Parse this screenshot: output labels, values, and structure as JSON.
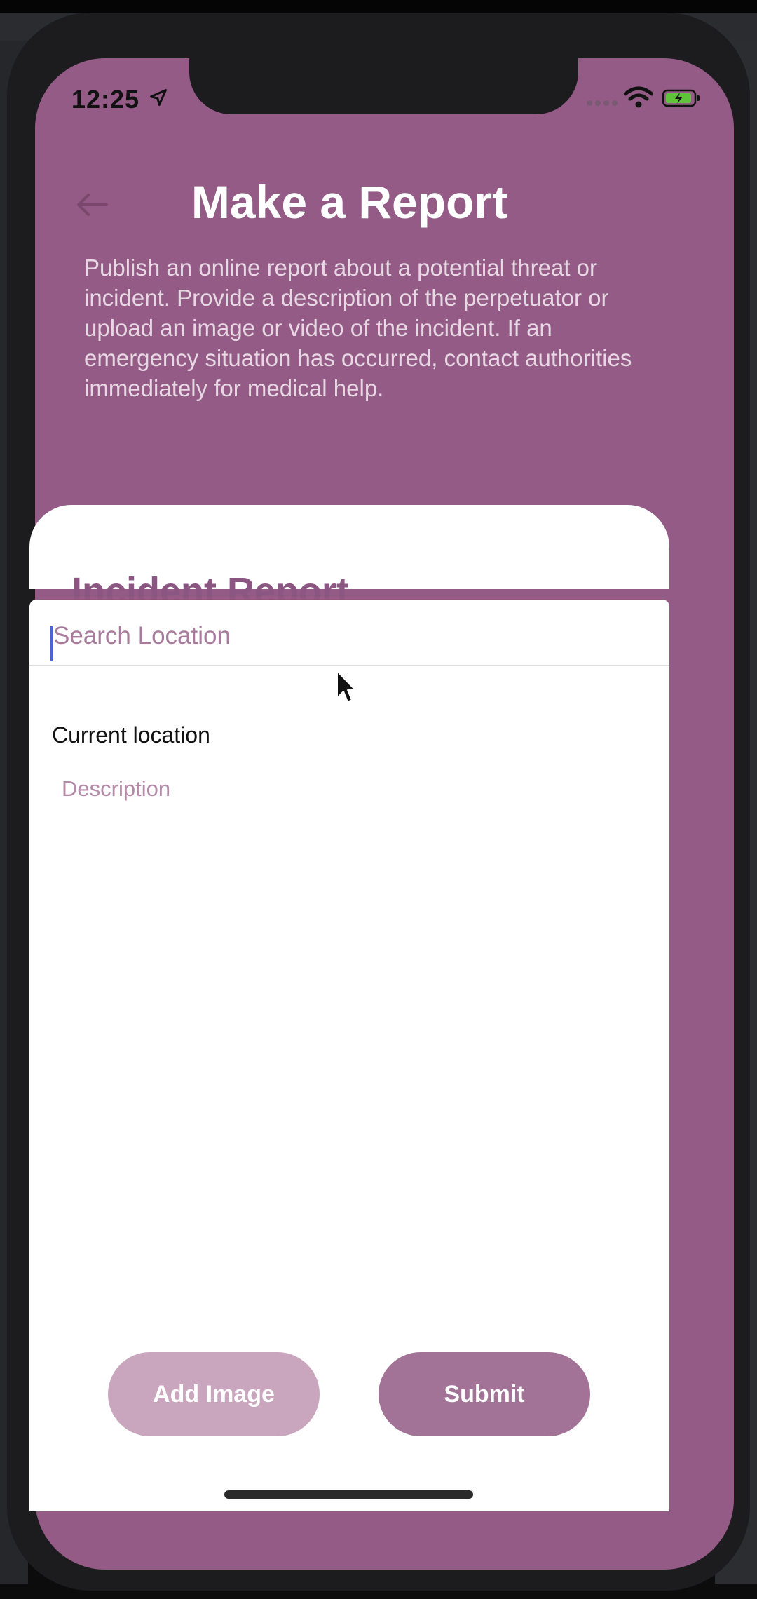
{
  "status_bar": {
    "time": "12:25"
  },
  "header": {
    "title": "Make a Report",
    "description": "Publish an online report about a potential threat or incident. Provide a description of the perpetuator or upload an image or video of the incident. If an emergency situation has occurred, contact authorities immediately for medical help."
  },
  "form": {
    "title": "Incident Report",
    "search_placeholder": "Search Location",
    "current_location_label": "Current location",
    "description_placeholder": "Description"
  },
  "buttons": {
    "add_image": "Add Image",
    "submit": "Submit"
  },
  "colors": {
    "primary": "#935b86",
    "accent": "#8c5682",
    "button_light": "#c9a6bd",
    "button": "#a27396"
  }
}
